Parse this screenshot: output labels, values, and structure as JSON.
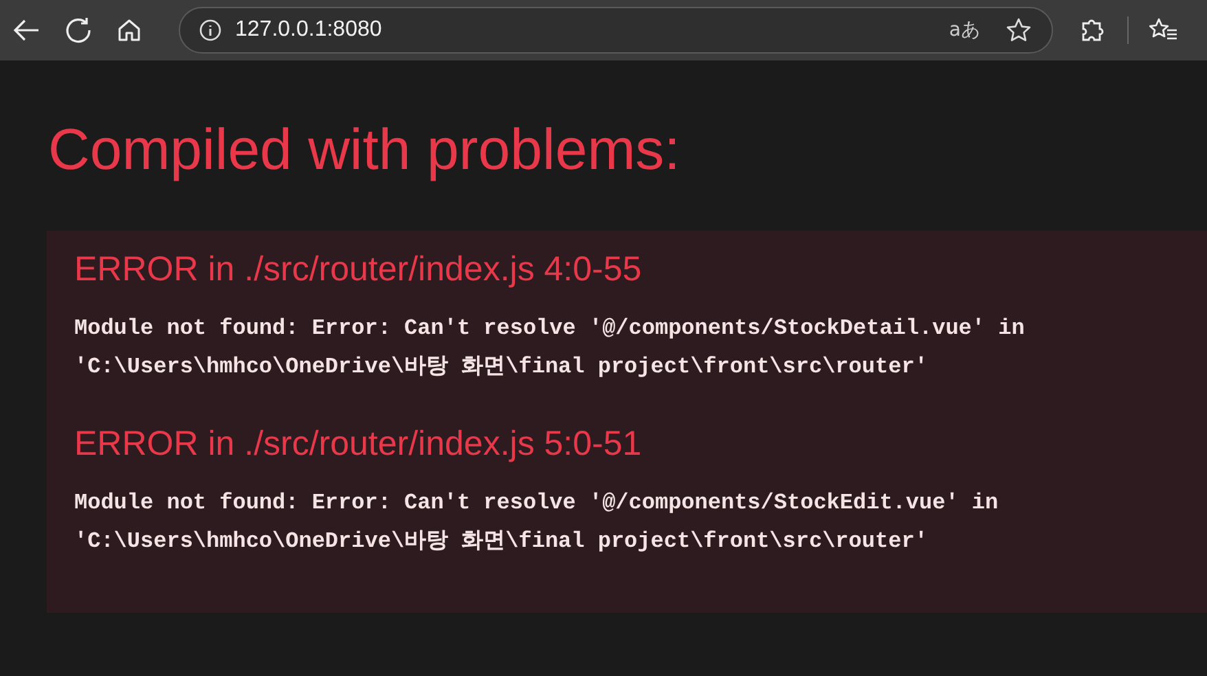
{
  "browser": {
    "url": "127.0.0.1:8080",
    "translate_icon": "aあ"
  },
  "overlay": {
    "title": "Compiled with problems:",
    "errors": [
      {
        "heading": "ERROR in ./src/router/index.js 4:0-55",
        "message": "Module not found: Error: Can't resolve '@/components/StockDetail.vue' in 'C:\\Users\\hmhco\\OneDrive\\바탕 화면\\final project\\front\\src\\router'"
      },
      {
        "heading": "ERROR in ./src/router/index.js 5:0-51",
        "message": "Module not found: Error: Can't resolve '@/components/StockEdit.vue' in 'C:\\Users\\hmhco\\OneDrive\\바탕 화면\\final project\\front\\src\\router'"
      }
    ]
  }
}
